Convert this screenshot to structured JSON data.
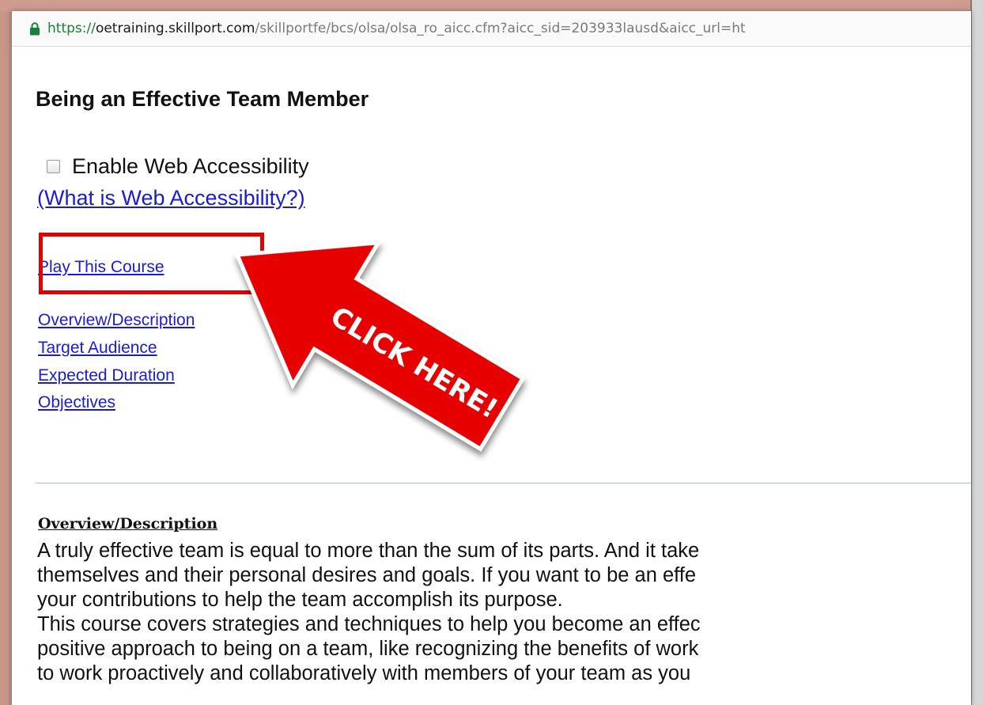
{
  "browser": {
    "url_secure": "https://",
    "url_host": "oetraining.skillport.com",
    "url_path": "/skillportfe/bcs/olsa/olsa_ro_aicc.cfm?aicc_sid=203933lausd&aicc_url=ht"
  },
  "page": {
    "title": "Being an Effective Team Member",
    "accessibility_label": "Enable Web Accessibility",
    "accessibility_link": "(What is Web Accessibility?)",
    "play_link": "Play This Course",
    "nav_links": [
      "Overview/Description",
      "Target Audience",
      "Expected Duration",
      "Objectives"
    ],
    "callout": "CLICK HERE!",
    "callout_color": "#e60000",
    "section_heading": "Overview/Description",
    "description_lines": [
      "A truly effective team is equal to more than the sum of its parts. And it take",
      "themselves and their personal desires and goals. If you want to be an effe",
      "your contributions to help the team accomplish its purpose.",
      "This course covers strategies and techniques to help you become an effec",
      "positive approach to being on a team, like recognizing the benefits of work",
      "to work proactively and collaboratively with members of your team as you"
    ]
  }
}
